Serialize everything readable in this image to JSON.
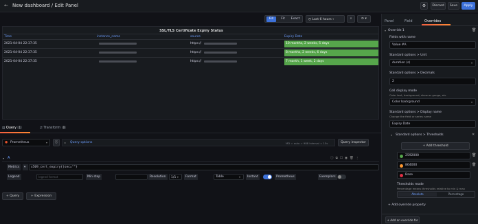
{
  "header": {
    "back_icon": "arrow-left-icon",
    "title": "New dashboard / Edit Panel",
    "settings_icon": "gear-icon",
    "discard_label": "Discard",
    "save_label": "Save",
    "apply_label": "Apply"
  },
  "viz_toolbar": {
    "fill_label": "Fill",
    "fit_label": "Fit",
    "exact_label": "Exact",
    "time_range": "Last 6 hours",
    "time_icon": "clock-icon",
    "zoom_icon": "zoom-out-icon",
    "refresh_icon": "refresh-icon"
  },
  "table": {
    "title": "SSL/TLS Certificate Expiry Status",
    "columns": [
      "Time",
      "instance_name",
      "source",
      "Expiry Date"
    ],
    "rows": [
      {
        "time": "2021-04-04 22:37:35",
        "source_prefix": "https://",
        "expiry": "10 months, 2 weeks, 5 days"
      },
      {
        "time": "2021-04-04 22:37:35",
        "source_prefix": "https://",
        "expiry": "8 months, 2 weeks, 6 days"
      },
      {
        "time": "2021-04-04 22:37:35",
        "source_prefix": "https://",
        "expiry": "7 month, 1 week, 2 days"
      }
    ],
    "cell_color": "#56a64b"
  },
  "query_tabs": {
    "query_label": "Query",
    "query_count": "1",
    "transform_label": "Transform",
    "transform_count": "0"
  },
  "query_bar": {
    "datasource": "Prometheus",
    "query_options_label": "Query options",
    "query_options_meta": "MD = auto = 988   Interval = 15s",
    "inspector_label": "Query inspector"
  },
  "query": {
    "ref_id": "A",
    "metrics_label": "Metrics",
    "expr": "x509_cert_expiry{(sec=\"\"}",
    "legend_label": "Legend",
    "legend_placeholder": "legend format",
    "min_step_label": "Min step",
    "resolution_label": "Resolution",
    "resolution_value": "1/1",
    "format_label": "Format",
    "format_value": "Table",
    "instant_label": "Instant",
    "prometheus_label": "Prometheus",
    "exemplars_label": "Exemplars",
    "add_query_label": "Query",
    "add_expression_label": "Expression"
  },
  "side": {
    "tabs": [
      "Panel",
      "Field",
      "Overrides"
    ],
    "override_title": "Override 1",
    "fields_with_name_label": "Fields with name",
    "fields_with_name_value": "Value #A",
    "unit_label": "Standard options > Unit",
    "unit_value": "duration (s)",
    "decimals_label": "Standard options > Decimals",
    "decimals_value": "2",
    "cell_display_label": "Cell display mode",
    "cell_display_desc": "Color text, background, show as gauge, etc",
    "cell_display_value": "Color background",
    "display_name_label": "Standard options > Display name",
    "display_name_desc": "Change the field or series name",
    "display_name_value": "Expiry Date",
    "thresholds_label": "Standard options > Thresholds",
    "add_threshold_label": "Add threshold",
    "thresholds": [
      {
        "value": "2592000",
        "color": "#56a64b"
      },
      {
        "value": "864000",
        "color": "#ff9830"
      },
      {
        "value": "Base",
        "color": "#e02f44"
      }
    ],
    "thresholds_mode_label": "Thresholds mode",
    "thresholds_mode_desc": "Percentage means thresholds relative to min & max",
    "mode_absolute": "Absolute",
    "mode_percentage": "Percentage",
    "add_override_property": "Add override property",
    "add_override_for": "Add an override for"
  }
}
